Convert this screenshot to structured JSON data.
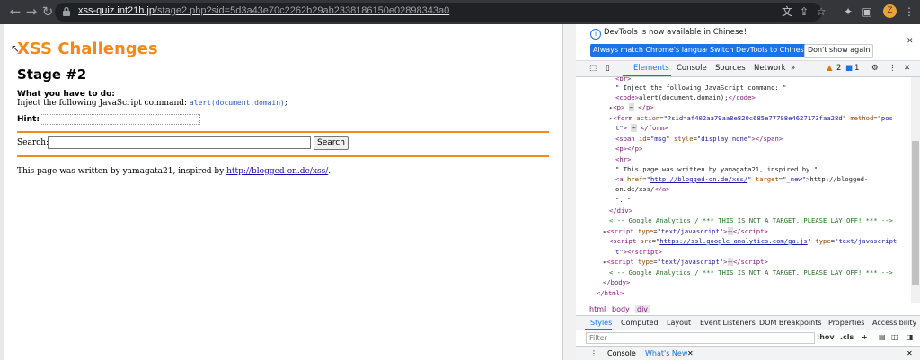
{
  "browser": {
    "url_host": "xss-quiz.int21h.jp",
    "url_path": "/stage2.php?sid=5d3a43e70c2262b29ab2338186150e02898343a0",
    "avatar_initial": "Z"
  },
  "page": {
    "logo": "XSS Challenges",
    "stage_title": "Stage #2",
    "task_heading": "What you have to do:",
    "task_text": "Inject the following JavaScript command: ",
    "task_code": "alert(document.domain)",
    "task_suffix": ";",
    "hint_label": "Hint:",
    "search_label": "Search:",
    "search_value": "",
    "search_button": "Search",
    "footer_text": "This page was written by yamagata21, inspired by ",
    "footer_link": "http://blogged-on.de/xss/",
    "footer_suffix": "."
  },
  "devtools": {
    "info_message": "DevTools is now available in Chinese!",
    "btn_match": "Always match Chrome's language",
    "btn_switch": "Switch DevTools to Chinese",
    "btn_dont_show": "Don't show again",
    "tabs": [
      "Elements",
      "Console",
      "Sources",
      "Network"
    ],
    "warn_count": "2",
    "info_count": "1",
    "breadcrumbs": [
      "html",
      "body",
      "div"
    ],
    "subtabs": [
      "Styles",
      "Computed",
      "Layout",
      "Event Listeners",
      "DOM Breakpoints",
      "Properties",
      "Accessibility"
    ],
    "filter_placeholder": "Filter",
    "hov": ":hov",
    "cls": ".cls",
    "drawer_console": "Console",
    "drawer_whatsnew": "What's New"
  },
  "colors": {
    "brand_orange": "#f28a1b",
    "devtools_blue": "#1a73e8"
  }
}
